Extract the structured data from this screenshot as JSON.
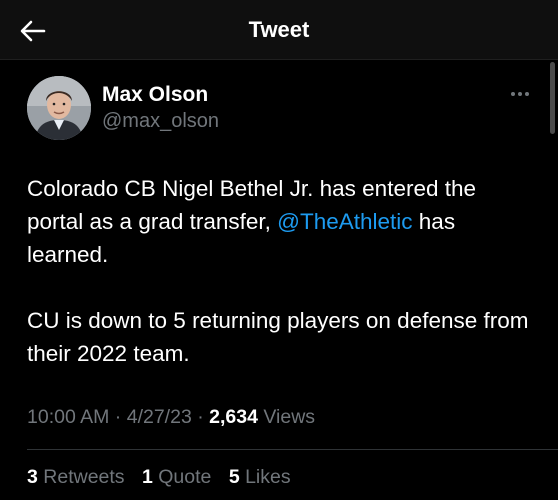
{
  "header": {
    "back_icon": "back-arrow-icon",
    "title": "Tweet"
  },
  "tweet": {
    "author": {
      "name": "Max Olson",
      "handle": "@max_olson",
      "avatar_icon": "profile-photo-icon"
    },
    "more_icon": "more-options-icon",
    "text": {
      "p1_a": "Colorado CB Nigel Bethel Jr. has entered the portal as a grad transfer, ",
      "p1_mention": "@TheAthletic",
      "p1_b": " has learned.",
      "p2": "CU is down to 5 returning players on defense from their 2022 team."
    },
    "meta": {
      "time": "10:00 AM",
      "sep1": " · ",
      "date": "4/27/23",
      "sep2": " · ",
      "views_count": "2,634",
      "views_label": " Views"
    },
    "stats": {
      "retweets_count": "3",
      "retweets_label": " Retweets",
      "quotes_count": "1",
      "quotes_label": " Quote",
      "likes_count": "5",
      "likes_label": " Likes"
    }
  },
  "colors": {
    "background": "#000000",
    "header_bg": "#0f0f0f",
    "text": "#ffffff",
    "secondary": "#71767b",
    "link": "#1d9bf0",
    "divider": "#2f3336"
  }
}
